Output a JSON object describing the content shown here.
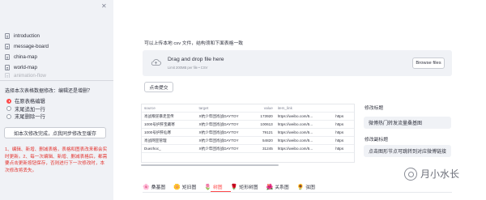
{
  "sidebar": {
    "close_icon": "close-icon",
    "nav_items": [
      {
        "label": "introduction",
        "icon": "document-icon"
      },
      {
        "label": "message-board",
        "icon": "document-icon"
      },
      {
        "label": "china-map",
        "icon": "document-icon"
      },
      {
        "label": "world-map",
        "icon": "document-icon"
      },
      {
        "label": "animation-flow",
        "icon": "document-icon"
      }
    ],
    "question": "选择本次表格数据修改：编辑还是增删？",
    "radio_options": [
      {
        "label": "在原表格编辑",
        "selected": true
      },
      {
        "label": "末尾追加一行",
        "selected": false
      },
      {
        "label": "末尾删除一行",
        "selected": false
      }
    ],
    "sync_button": "如本次修改完成，点我同步修改至缓存",
    "note": "1、编辑、新增、删减表格，表格和图表改来都会实时更新。2、每一次编辑、新增、删减表格后，都需要点击更新按钮保存，否则进行下一次修改时，本次修改将丢失。"
  },
  "upload": {
    "title": "可以上传本地 csv 文件，结构须和下面表格一致",
    "drop_title": "Drag and drop file here",
    "drop_sub": "Limit 200MB per file • CSV",
    "browse": "Browse files",
    "submit": "点击提交"
  },
  "table": {
    "columns": [
      "source",
      "target",
      "value",
      "item_link",
      ""
    ],
    "rows": [
      [
        "肖战叛逆暴走宣传",
        "X抗少年团肖战DAYTOY",
        "173920",
        "https://weibo.com/5...",
        "https"
      ],
      [
        "1000号护肝宝藏寒",
        "X抗少年团肖战DAYTOY",
        "100613",
        "https://weibo.com/5...",
        "https"
      ],
      [
        "1000号护肝仙寒",
        "X抗少年团肖战DAYTOY",
        "79121",
        "https://weibo.com/5...",
        "https"
      ],
      [
        "肖战网宣管理",
        "X抗少年团肖战DAYTOY",
        "54820",
        "https://weibo.com/5...",
        "https"
      ],
      [
        "Duezhoc_",
        "X抗少年团肖战DAYTOY",
        "31245",
        "https://weibo.com/5...",
        "https"
      ]
    ]
  },
  "right_panel": {
    "label1": "修改标题",
    "value1": "微博热门转发流量桑基图",
    "label2": "修改副标题",
    "value2": "点击图形节点可跳转到对应微博链接"
  },
  "tabs": [
    {
      "label": "桑基图",
      "icon": "🌸",
      "active": false
    },
    {
      "label": "矩旧图",
      "icon": "🌼",
      "active": false
    },
    {
      "label": "树图",
      "icon": "🌷",
      "active": true
    },
    {
      "label": "矩形树图",
      "icon": "🌹",
      "active": false
    },
    {
      "label": "关系图",
      "icon": "🌺",
      "active": false
    },
    {
      "label": "弦图",
      "icon": "🌻",
      "active": false
    }
  ],
  "watermark": "月小水长",
  "colors": {
    "accent": "#ff4b4b",
    "sidebar_bg": "#f0f2f6",
    "note_red": "#e3342f"
  }
}
